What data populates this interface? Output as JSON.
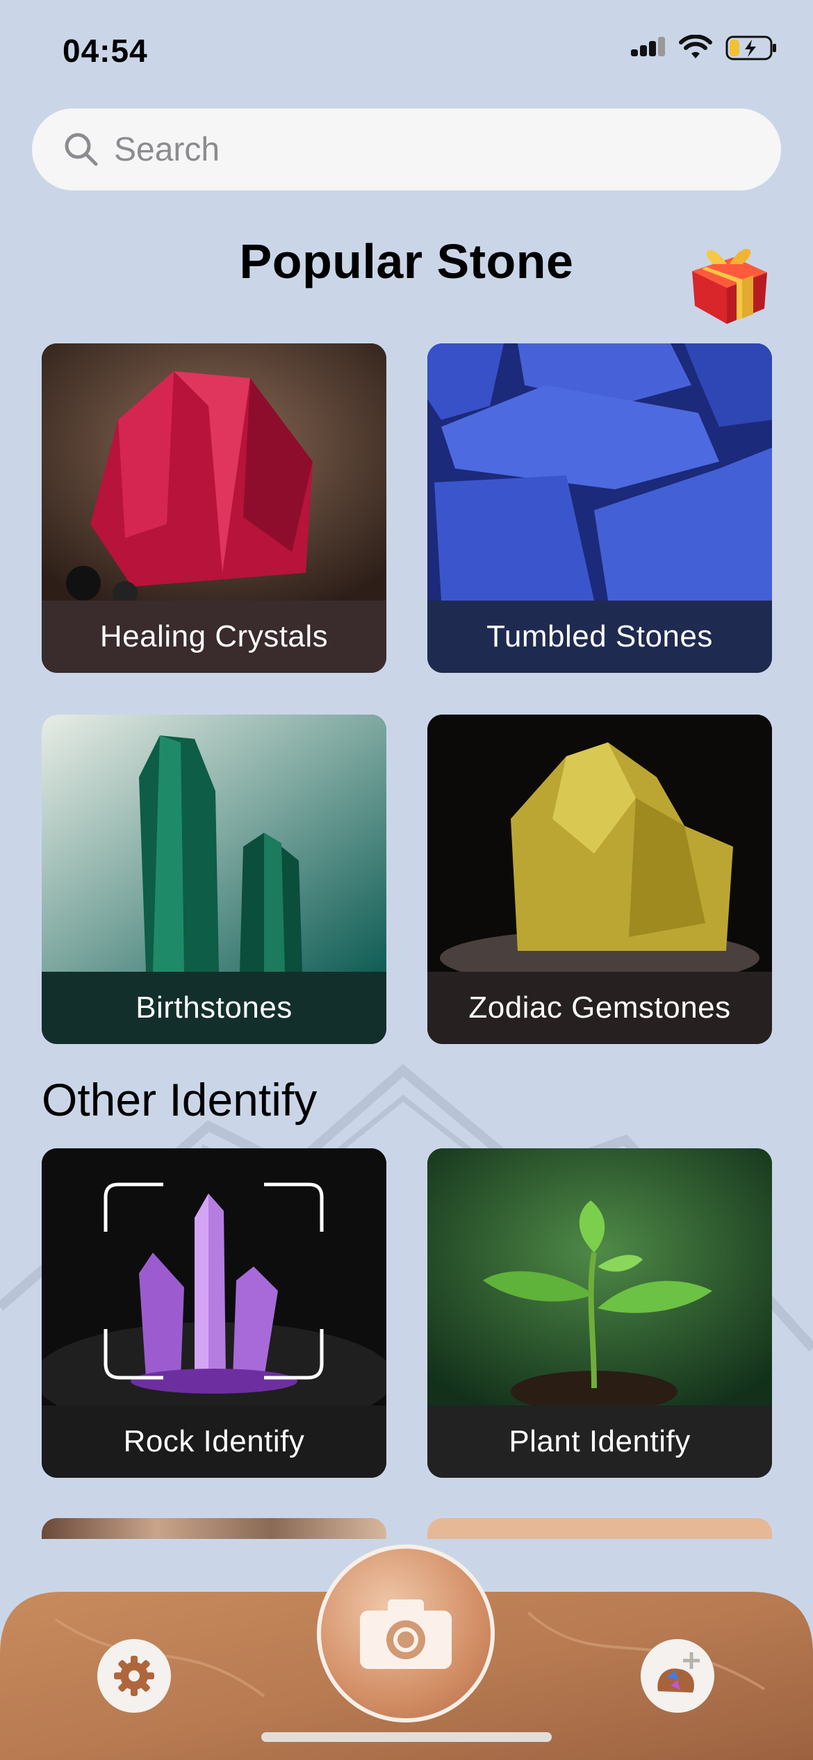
{
  "status_bar": {
    "time": "04:54"
  },
  "search": {
    "placeholder": "Search",
    "value": ""
  },
  "popular": {
    "title": "Popular Stone",
    "cards": [
      {
        "label": "Healing Crystals"
      },
      {
        "label": "Tumbled Stones"
      },
      {
        "label": "Birthstones"
      },
      {
        "label": "Zodiac Gemstones"
      }
    ]
  },
  "other": {
    "title": "Other Identify",
    "cards": [
      {
        "label": "Rock Identify"
      },
      {
        "label": "Plant Identify"
      }
    ]
  },
  "tab_bar": {
    "settings_icon": "gear-icon",
    "scan_icon": "camera-icon",
    "collection_icon": "collection-add-icon"
  },
  "colors": {
    "background": "#cad6e8",
    "accent_brown": "#b5764e"
  }
}
